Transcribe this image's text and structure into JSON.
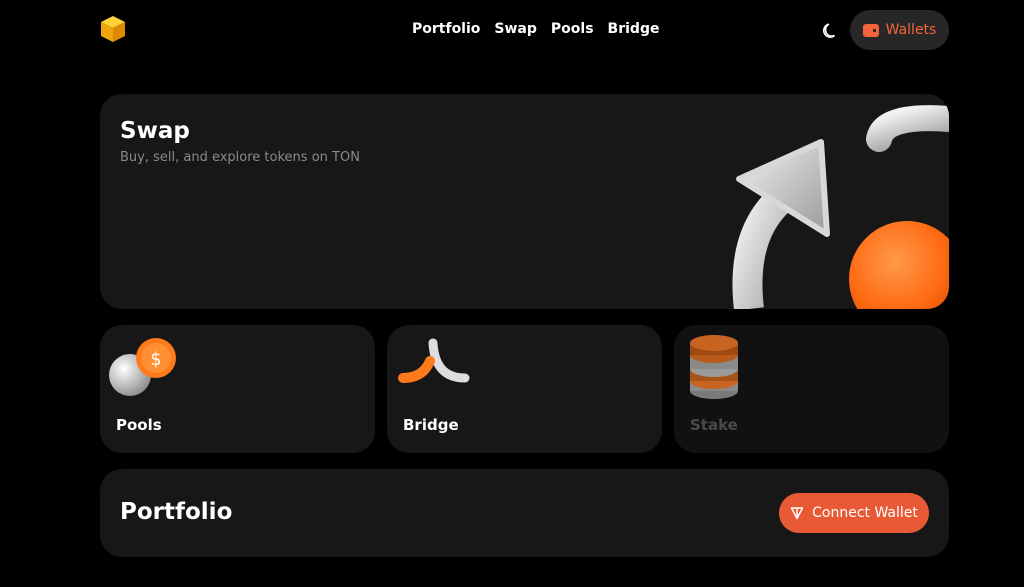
{
  "header": {
    "logo": "cube-logo",
    "nav": [
      {
        "label": "Portfolio"
      },
      {
        "label": "Swap"
      },
      {
        "label": "Pools"
      },
      {
        "label": "Bridge"
      }
    ],
    "theme_icon": "moon-icon",
    "wallets_label": "Wallets",
    "wallet_icon": "wallet-icon"
  },
  "swap": {
    "title": "Swap",
    "subtitle": "Buy, sell, and explore tokens on TON"
  },
  "cards": {
    "pools": {
      "label": "Pools"
    },
    "bridge": {
      "label": "Bridge"
    },
    "stake": {
      "label": "Stake"
    }
  },
  "portfolio": {
    "title": "Portfolio",
    "connect_label": "Connect Wallet",
    "connect_icon": "ton-icon"
  },
  "colors": {
    "accent": "#e85a36",
    "card_bg": "#171717",
    "background": "#000000",
    "muted_text": "#8a8a8a"
  }
}
